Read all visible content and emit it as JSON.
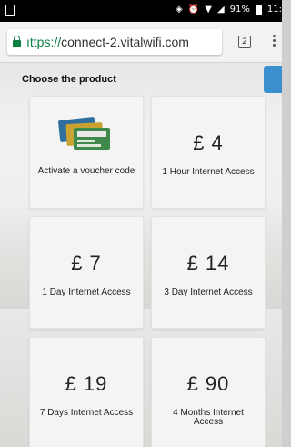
{
  "status_bar": {
    "battery": "91%",
    "time": "11:"
  },
  "browser": {
    "url_scheme": "ıttps://",
    "url_host": "connect-2.vitalwifi.com",
    "tab_count": "2"
  },
  "page": {
    "heading": "Choose the product",
    "products": [
      {
        "price": "",
        "label": "Activate a voucher code",
        "icon": "voucher-cards-icon"
      },
      {
        "price": "£ 4",
        "label": "1 Hour Internet Access"
      },
      {
        "price": "£ 7",
        "label": "1 Day Internet Access"
      },
      {
        "price": "£ 14",
        "label": "3 Day Internet Access"
      },
      {
        "price": "£ 19",
        "label": "7 Days Internet Access"
      },
      {
        "price": "£ 90",
        "label": "4 Months Internet Access"
      }
    ]
  },
  "colors": {
    "accent": "#3a8fcf",
    "secure": "#0b8043"
  }
}
